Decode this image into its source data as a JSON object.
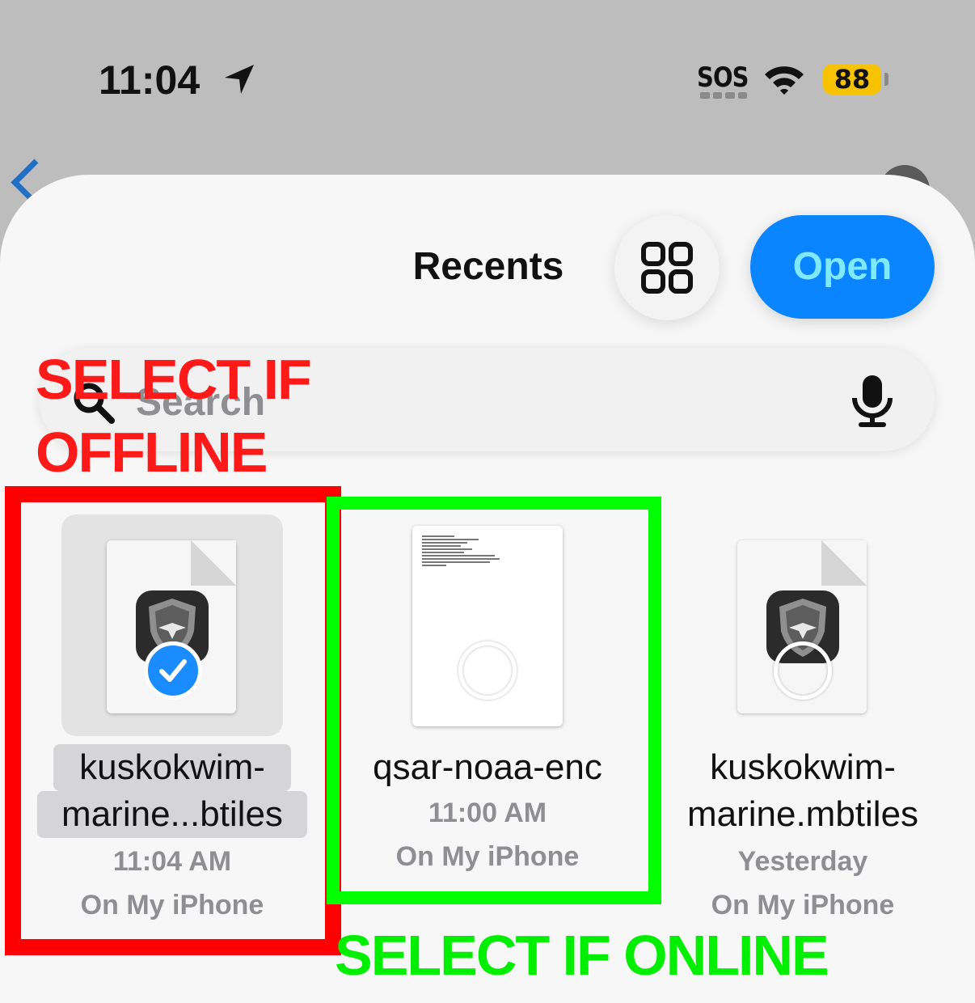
{
  "status_bar": {
    "time": "11:04",
    "carrier": "SOS",
    "battery": "88"
  },
  "sheet": {
    "title": "Recents",
    "open_button": "Open",
    "search_placeholder": "Search"
  },
  "annotations": {
    "offline_line1": "SELECT IF",
    "offline_line2": "OFFLINE",
    "online": "SELECT IF ONLINE"
  },
  "files": [
    {
      "name_line1": "kuskokwim-",
      "name_line2": "marine...btiles",
      "time": "11:04 AM",
      "location": "On My iPhone",
      "selected": true
    },
    {
      "name_line1": "qsar-noaa-enc",
      "time": "11:00 AM",
      "location": "On My iPhone",
      "selected": false
    },
    {
      "name_line1": "kuskokwim-",
      "name_line2": "marine.mbtiles",
      "time": "Yesterday",
      "location": "On My iPhone",
      "selected": false
    }
  ],
  "colors": {
    "accent": "#0a84ff",
    "offline_annotation": "#ff0000",
    "online_annotation": "#00ff00",
    "battery": "#f7c300"
  },
  "icons": [
    "location-arrow-icon",
    "wifi-icon",
    "grid-view-icon",
    "search-icon",
    "microphone-icon",
    "checkmark-icon",
    "app-shield-icon"
  ]
}
